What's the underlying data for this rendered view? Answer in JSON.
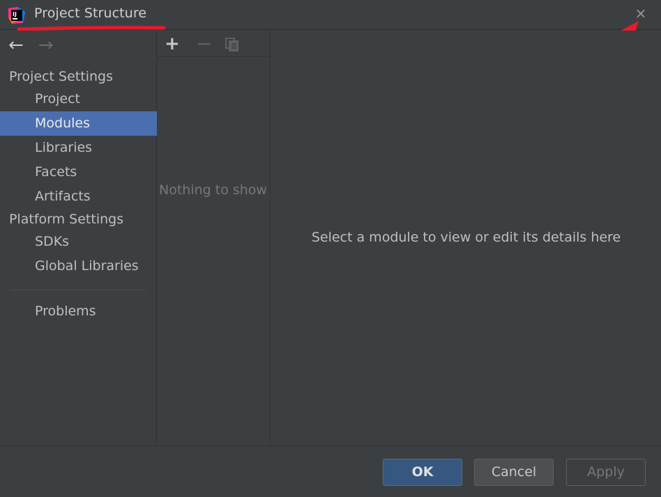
{
  "window": {
    "title": "Project Structure",
    "close_glyph": "×"
  },
  "navigation": {
    "back_glyph": "←",
    "forward_glyph": "→"
  },
  "sidebar": {
    "project_settings_label": "Project Settings",
    "items": [
      {
        "label": "Project"
      },
      {
        "label": "Modules",
        "selected": true
      },
      {
        "label": "Libraries"
      },
      {
        "label": "Facets"
      },
      {
        "label": "Artifacts"
      }
    ],
    "platform_settings_label": "Platform Settings",
    "platform_items": [
      {
        "label": "SDKs"
      },
      {
        "label": "Global Libraries"
      }
    ],
    "problems_label": "Problems"
  },
  "module_list": {
    "add_glyph": "+",
    "remove_glyph": "−",
    "empty_text": "Nothing to show"
  },
  "details": {
    "hint": "Select a module to view or edit its details here"
  },
  "footer": {
    "ok_label": "OK",
    "cancel_label": "Cancel",
    "apply_label": "Apply"
  },
  "colors": {
    "background": "#3c3f41",
    "selection": "#4b6eaf",
    "ok_button": "#365880",
    "annotation_red": "#e8192c"
  },
  "icons": {
    "app_logo": "intellij-logo-icon",
    "close": "close-icon",
    "copy": "copy-icon",
    "annotation": "red-arrow-pointer"
  }
}
